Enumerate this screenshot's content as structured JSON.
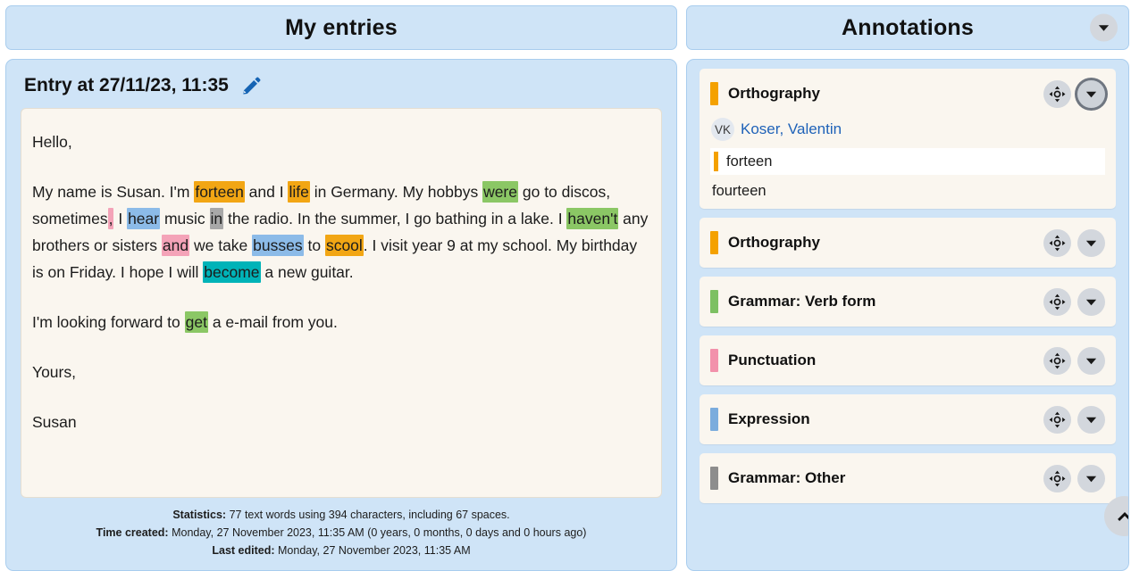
{
  "left": {
    "header_title": "My entries",
    "entry_title": "Entry at 27/11/23, 11:35",
    "pencil_icon": "pencil-icon",
    "paragraphs": [
      [
        {
          "t": "Hello,",
          "c": null
        }
      ],
      [
        {
          "t": "My name is Susan. I'm ",
          "c": null
        },
        {
          "t": "forteen",
          "c": "orange"
        },
        {
          "t": " and I ",
          "c": null
        },
        {
          "t": "life",
          "c": "orange"
        },
        {
          "t": " in Germany. My hobbys ",
          "c": null
        },
        {
          "t": "were",
          "c": "green"
        },
        {
          "t": " go to discos, sometimes",
          "c": null
        },
        {
          "t": ",",
          "c": "pink"
        },
        {
          "t": " I ",
          "c": null
        },
        {
          "t": "hear",
          "c": "blue"
        },
        {
          "t": " music ",
          "c": null
        },
        {
          "t": "in",
          "c": "gray"
        },
        {
          "t": " the radio. In the summer, I go bathing in a lake. I ",
          "c": null
        },
        {
          "t": "haven't",
          "c": "green"
        },
        {
          "t": " any brothers or sisters ",
          "c": null
        },
        {
          "t": "and",
          "c": "pink"
        },
        {
          "t": " we take ",
          "c": null
        },
        {
          "t": "busses",
          "c": "blue"
        },
        {
          "t": " to ",
          "c": null
        },
        {
          "t": "scool",
          "c": "orange"
        },
        {
          "t": ". I visit year 9 at my school. My birthday is on Friday. I hope I will ",
          "c": null
        },
        {
          "t": "become",
          "c": "teal"
        },
        {
          "t": " a new guitar.",
          "c": null
        }
      ],
      [
        {
          "t": "I'm looking forward to ",
          "c": null
        },
        {
          "t": "get",
          "c": "green"
        },
        {
          "t": " a e-mail from you.",
          "c": null
        }
      ],
      [
        {
          "t": "Yours,",
          "c": null
        }
      ],
      [
        {
          "t": "Susan",
          "c": null
        }
      ]
    ],
    "stats": {
      "statistics_label": "Statistics:",
      "statistics_value": "77 text words using 394 characters, including 67 spaces.",
      "time_created_label": "Time created:",
      "time_created_value": "Monday, 27 November 2023, 11:35 AM (0 years, 0 months, 0 days and 0 hours ago)",
      "last_edited_label": "Last edited:",
      "last_edited_value": "Monday, 27 November 2023, 11:35 AM"
    }
  },
  "right": {
    "header_title": "Annotations",
    "header_toggle_icon": "chevron-down-icon",
    "scroll_top_icon": "chevron-up-icon",
    "cards": [
      {
        "category": "Orthography",
        "color": "#f4a100",
        "expanded": true,
        "author_initials": "VK",
        "author_name": "Koser, Valentin",
        "quoted_text": "forteen",
        "correction": "fourteen",
        "move_icon": "move-target-icon",
        "toggle_icon": "chevron-down-icon"
      },
      {
        "category": "Orthography",
        "color": "#f4a100",
        "expanded": false,
        "move_icon": "move-target-icon",
        "toggle_icon": "chevron-down-icon"
      },
      {
        "category": "Grammar: Verb form",
        "color": "#7dc063",
        "expanded": false,
        "move_icon": "move-target-icon",
        "toggle_icon": "chevron-down-icon"
      },
      {
        "category": "Punctuation",
        "color": "#f291ab",
        "expanded": false,
        "move_icon": "move-target-icon",
        "toggle_icon": "chevron-down-icon"
      },
      {
        "category": "Expression",
        "color": "#7bacdd",
        "expanded": false,
        "move_icon": "move-target-icon",
        "toggle_icon": "chevron-down-icon"
      },
      {
        "category": "Grammar: Other",
        "color": "#8d8d8d",
        "expanded": false,
        "move_icon": "move-target-icon",
        "toggle_icon": "chevron-down-icon"
      }
    ]
  },
  "highlight_colors": {
    "orange": "#f2a614",
    "green": "#8bc765",
    "blue": "#8cbbe8",
    "pink": "#f4a3b8",
    "gray": "#a8a8a8",
    "teal": "#00b3b8"
  }
}
